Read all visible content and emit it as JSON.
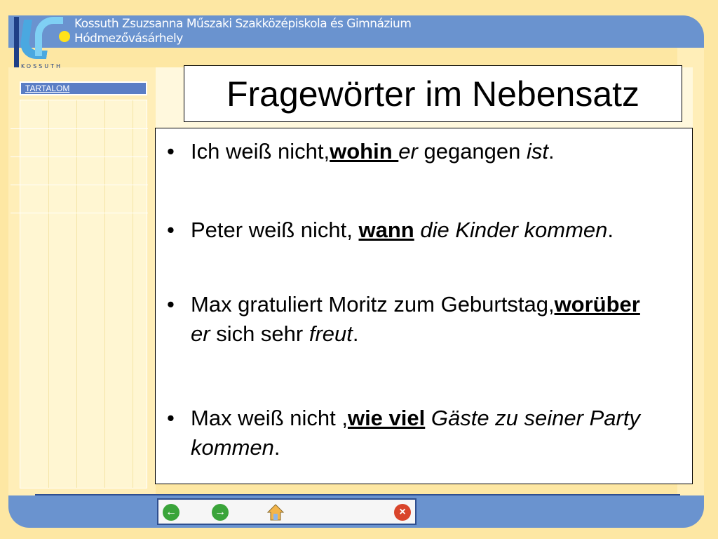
{
  "header": {
    "logo_text": "KOSSUTH",
    "school_line1": "Kossuth Zsuzsanna Műszaki Szakközépiskola és Gimnázium",
    "school_line2": "Hódmezővásárhely"
  },
  "sidebar": {
    "toc_label": "TARTALOM"
  },
  "slide": {
    "title": "Fragewörter im Nebensatz",
    "bullets": [
      {
        "pre": "Ich weiß nicht,",
        "keyword": "wohin ",
        "it1": "er",
        "mid": " gegangen ",
        "it2": "ist",
        "post": "."
      },
      {
        "pre": "Peter weiß nicht, ",
        "keyword": "wann",
        "it1": " die Kinder kommen",
        "mid": "",
        "it2": "",
        "post": "."
      },
      {
        "pre": "Max gratuliert Moritz zum Geburtstag,",
        "keyword": "worüber",
        "it1": " er",
        "mid": " sich sehr ",
        "it2": "freut",
        "post": "."
      },
      {
        "pre": "Max weiß nicht ,",
        "keyword": "wie viel",
        "it1": " Gäste zu seiner Party kommen",
        "mid": "",
        "it2": "",
        "post": "."
      }
    ],
    "bullet_char": "•"
  },
  "navigation": {
    "back_icon": "arrow-left-icon",
    "forward_icon": "arrow-right-icon",
    "home_icon": "home-icon",
    "close_icon": "close-icon",
    "back_glyph": "←",
    "forward_glyph": "→",
    "close_glyph": "×"
  },
  "colors": {
    "header_blue": "#6a93cf",
    "background_yellow": "#fde7a3",
    "nav_green": "#3aa43a",
    "nav_red": "#d9452b"
  }
}
